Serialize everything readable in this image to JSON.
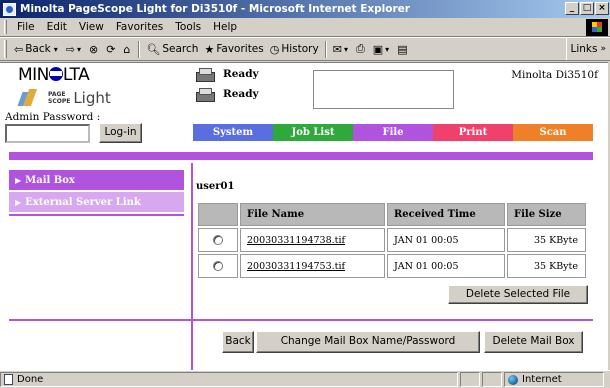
{
  "window": {
    "title": "Minolta PageScope Light for Di3510f - Microsoft Internet Explorer",
    "controls": [
      "_",
      "□",
      "×"
    ]
  },
  "menu": [
    "File",
    "Edit",
    "View",
    "Favorites",
    "Tools",
    "Help"
  ],
  "toolbar": {
    "back": "Back",
    "search": "Search",
    "favorites": "Favorites",
    "history": "History",
    "links": "Links"
  },
  "header": {
    "brand": "MIN",
    "brand_rest": "LTA",
    "logo_text_top": "PAGE",
    "logo_text_bottom": "SCOPE",
    "logo_light": "Light",
    "status": [
      "Ready",
      "Ready"
    ],
    "model": "Minolta Di3510f"
  },
  "admin": {
    "label": "Admin Password :",
    "password_value": "",
    "login_button": "Log-in"
  },
  "tabs": [
    {
      "label": "System",
      "color": "#5b6ee0"
    },
    {
      "label": "Job List",
      "color": "#2fa83c"
    },
    {
      "label": "File",
      "color": "#b054e0"
    },
    {
      "label": "Print",
      "color": "#f0406c"
    },
    {
      "label": "Scan",
      "color": "#f08028"
    }
  ],
  "leftnav": [
    {
      "label": "Mail Box"
    },
    {
      "label": "External Server Link"
    }
  ],
  "mailbox": {
    "user": "user01",
    "columns": [
      "File Name",
      "Received Time",
      "File Size"
    ],
    "rows": [
      {
        "file": "20030331194738.tif",
        "time": "JAN 01 00:05",
        "size": "35 KByte"
      },
      {
        "file": "20030331194753.tif",
        "time": "JAN 01 00:05",
        "size": "35 KByte"
      }
    ],
    "delete_selected": "Delete Selected File"
  },
  "actions": {
    "back": "Back",
    "change": "Change Mail Box Name/Password",
    "delete_mailbox": "Delete Mail Box"
  },
  "statusbar": {
    "left": "Done",
    "zone": "Internet"
  }
}
